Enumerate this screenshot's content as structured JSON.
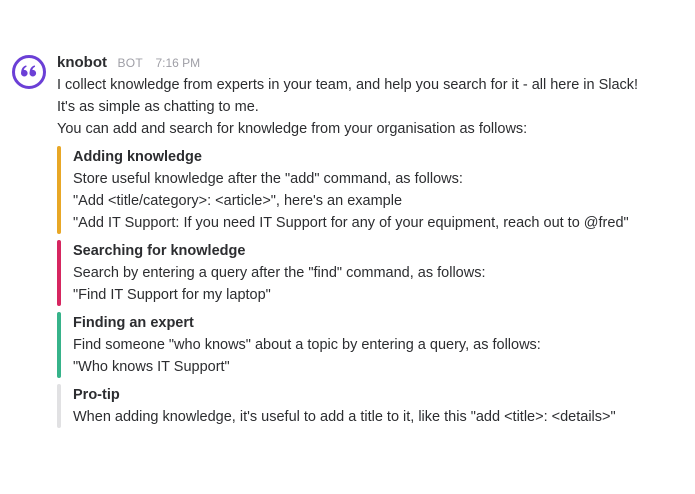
{
  "message": {
    "username": "knobot",
    "badge": "BOT",
    "timestamp": "7:16 PM",
    "avatar_icon": "quote-icon",
    "lines": [
      "I collect knowledge from experts in your team, and help you search for it - all here in Slack!",
      "It's as simple as chatting to me.",
      "You can add and search for knowledge from your organisation as follows:"
    ]
  },
  "colors": {
    "avatar": "#6b3fd6",
    "adding": "#e8a726",
    "searching": "#d62660",
    "finding": "#36b38a",
    "protip": "#e1e1e3"
  },
  "attachments": [
    {
      "title": "Adding knowledge",
      "lines": [
        "Store useful knowledge after the \"add\" command, as follows:",
        "\"Add <title/category>: <article>\", here's an example",
        "\"Add IT Support: If you need IT Support for any of your equipment, reach out to @fred\""
      ]
    },
    {
      "title": "Searching for knowledge",
      "lines": [
        "Search by entering a query after the \"find\" command, as follows:",
        "\"Find IT Support for my laptop\""
      ]
    },
    {
      "title": "Finding an expert",
      "lines": [
        "Find someone \"who knows\" about a topic by entering a query, as follows:",
        "\"Who knows IT Support\""
      ]
    },
    {
      "title": "Pro-tip",
      "lines": [
        "When adding knowledge, it's useful to add a title to it, like this \"add <title>: <details>\""
      ]
    }
  ]
}
